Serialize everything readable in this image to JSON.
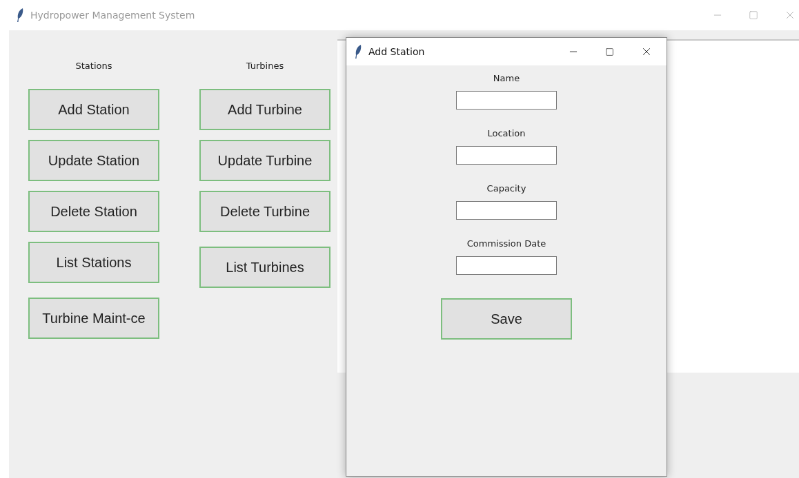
{
  "window": {
    "title": "Hydropower Management System"
  },
  "columns": [
    {
      "heading": "Stations",
      "buttons": [
        "Add Station",
        "Update Station",
        "Delete Station",
        "List Stations",
        "Turbine Maint-ce"
      ]
    },
    {
      "heading": "Turbines",
      "buttons": [
        "Add Turbine",
        "Update Turbine",
        "Delete Turbine",
        "List Turbines"
      ]
    }
  ],
  "dialog": {
    "title": "Add Station",
    "fields": [
      {
        "label": "Name"
      },
      {
        "label": "Location"
      },
      {
        "label": "Capacity"
      },
      {
        "label": "Commission Date"
      }
    ],
    "button": "Save"
  }
}
